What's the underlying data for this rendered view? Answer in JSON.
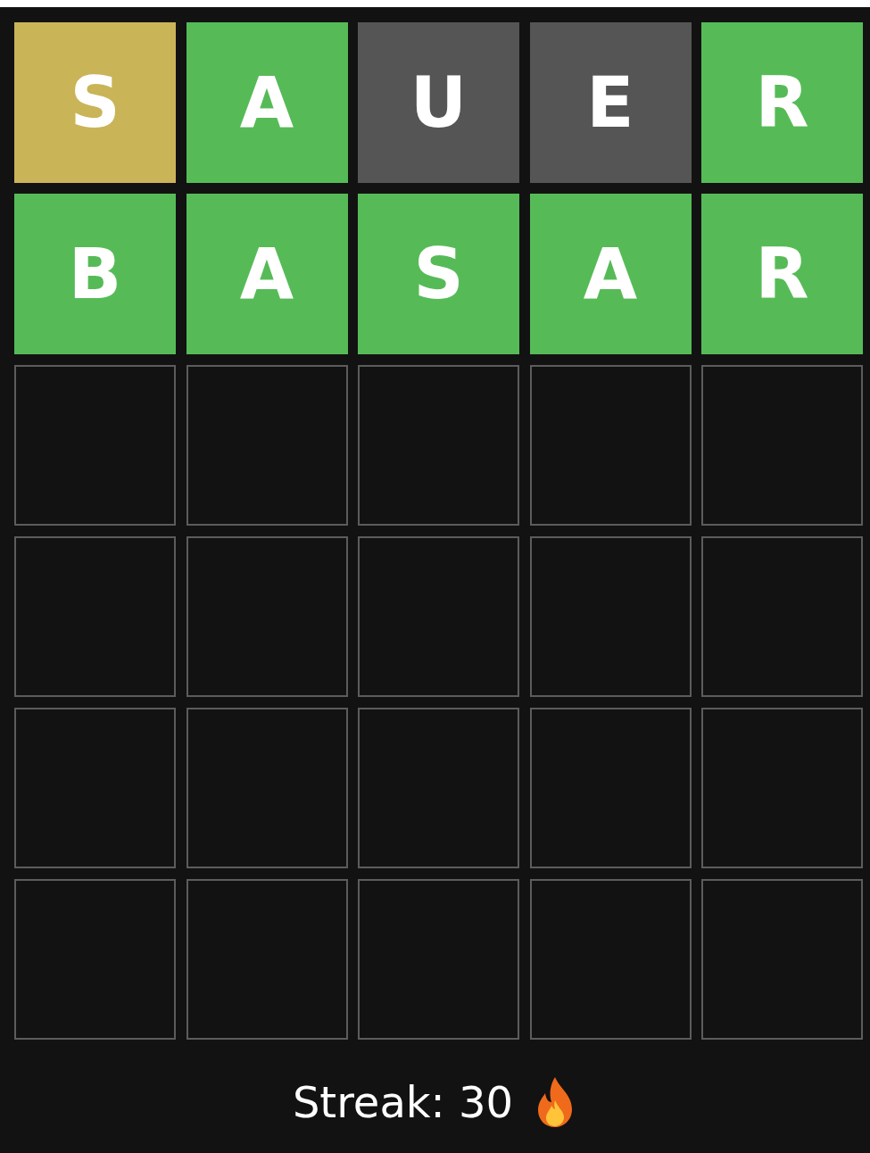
{
  "board": {
    "rows": [
      {
        "tiles": [
          {
            "letter": "S",
            "filled": true,
            "color": "#c9b458"
          },
          {
            "letter": "A",
            "filled": true,
            "color": "#56bb57"
          },
          {
            "letter": "U",
            "filled": true,
            "color": "#555555"
          },
          {
            "letter": "E",
            "filled": true,
            "color": "#555555"
          },
          {
            "letter": "R",
            "filled": true,
            "color": "#56bb57"
          }
        ]
      },
      {
        "tiles": [
          {
            "letter": "B",
            "filled": true,
            "color": "#56bb57"
          },
          {
            "letter": "A",
            "filled": true,
            "color": "#56bb57"
          },
          {
            "letter": "S",
            "filled": true,
            "color": "#56bb57"
          },
          {
            "letter": "A",
            "filled": true,
            "color": "#56bb57"
          },
          {
            "letter": "R",
            "filled": true,
            "color": "#56bb57"
          }
        ]
      },
      {
        "tiles": [
          {
            "filled": false
          },
          {
            "filled": false
          },
          {
            "filled": false
          },
          {
            "filled": false
          },
          {
            "filled": false
          }
        ]
      },
      {
        "tiles": [
          {
            "filled": false
          },
          {
            "filled": false
          },
          {
            "filled": false
          },
          {
            "filled": false
          },
          {
            "filled": false
          }
        ]
      },
      {
        "tiles": [
          {
            "filled": false
          },
          {
            "filled": false
          },
          {
            "filled": false
          },
          {
            "filled": false
          },
          {
            "filled": false
          }
        ]
      },
      {
        "tiles": [
          {
            "filled": false
          },
          {
            "filled": false
          },
          {
            "filled": false
          },
          {
            "filled": false
          },
          {
            "filled": false
          }
        ]
      }
    ]
  },
  "streak": {
    "label": "Streak: 30"
  }
}
